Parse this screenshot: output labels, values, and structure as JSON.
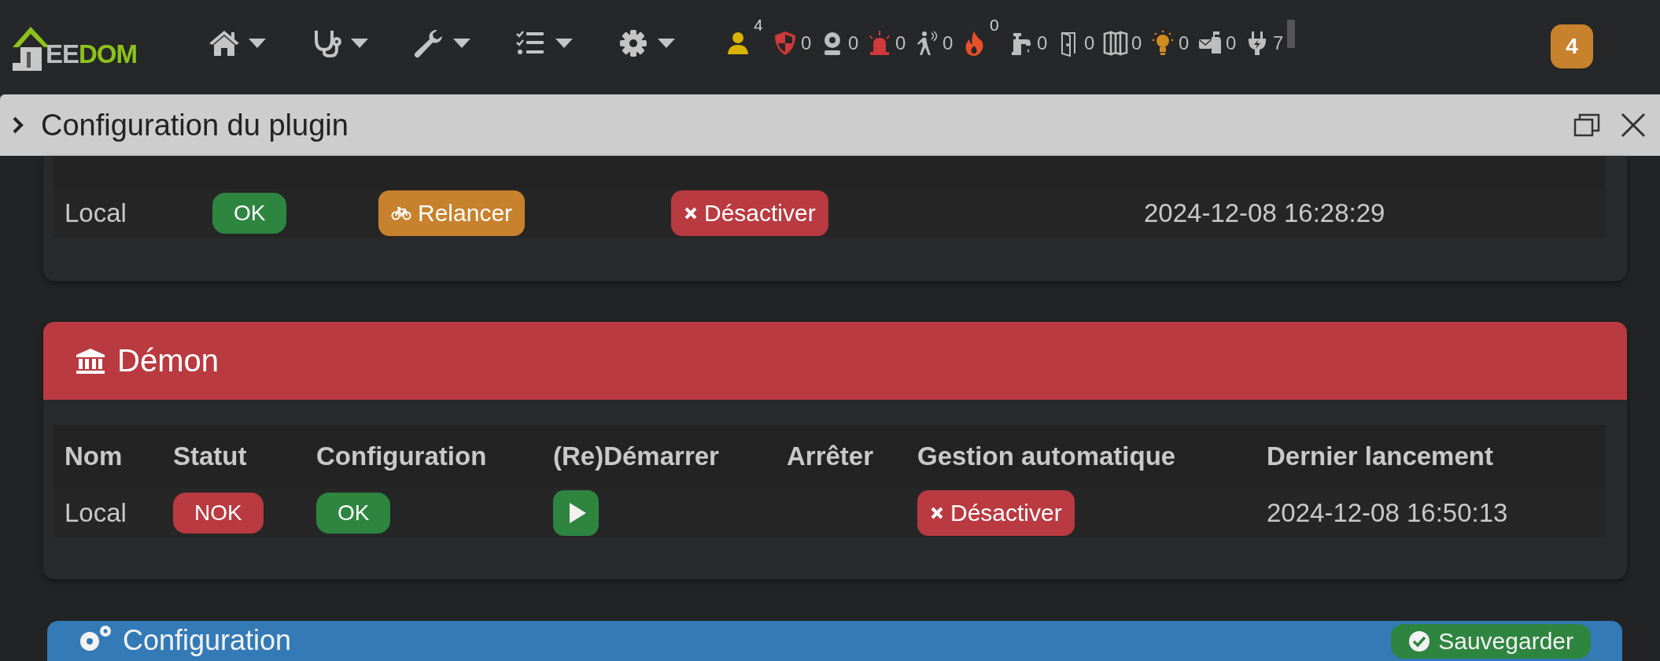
{
  "navbar": {
    "logo": {
      "part_1": "EE",
      "part_2": "DOM"
    },
    "menus": [
      {
        "kind": "home"
      },
      {
        "kind": "stethoscope"
      },
      {
        "kind": "wrench"
      },
      {
        "kind": "checklist"
      },
      {
        "kind": "gear"
      }
    ],
    "status": [
      {
        "kind": "person",
        "count": "4",
        "raised": true,
        "color": "#d9b300"
      },
      {
        "kind": "shield",
        "count": "0",
        "raised": false,
        "color": "#d03a3a"
      },
      {
        "kind": "camera",
        "count": "0",
        "raised": false,
        "color": "#bdbdbd"
      },
      {
        "kind": "siren",
        "count": "0",
        "raised": false,
        "color": "#d03a3a"
      },
      {
        "kind": "walker",
        "count": "0",
        "raised": false,
        "color": "#bdbdbd"
      },
      {
        "kind": "flame",
        "count": "0",
        "raised": true,
        "color": "#e8502a"
      },
      {
        "kind": "tap",
        "count": "0",
        "raised": false,
        "color": "#bdbdbd"
      },
      {
        "kind": "door",
        "count": "0",
        "raised": false,
        "color": "#bdbdbd"
      },
      {
        "kind": "window",
        "count": "0",
        "raised": false,
        "color": "#bdbdbd"
      },
      {
        "kind": "bulb",
        "count": "0",
        "raised": false,
        "color": "#d08a1e"
      },
      {
        "kind": "mailbox",
        "count": "0",
        "raised": false,
        "color": "#bdbdbd"
      },
      {
        "kind": "plug",
        "count": "7",
        "raised": false,
        "color": "#bdbdbd"
      }
    ],
    "notification_badge": "4"
  },
  "panel": {
    "title": "Configuration du plugin"
  },
  "dependencies": {
    "rows": [
      {
        "name": "Local",
        "status": {
          "label": "OK",
          "ok": true
        },
        "install_button": "Relancer",
        "auto_button": "Désactiver",
        "last": "2024-12-08 16:28:29"
      }
    ]
  },
  "daemon": {
    "title": "Démon",
    "ok": false,
    "columns": [
      "Nom",
      "Statut",
      "Configuration",
      "(Re)Démarrer",
      "Arrêter",
      "Gestion automatique",
      "Dernier lancement"
    ],
    "rows": [
      {
        "name": "Local",
        "status": {
          "label": "NOK",
          "ok": false
        },
        "config": {
          "label": "OK",
          "ok": true
        },
        "auto_button": "Désactiver",
        "last": "2024-12-08 16:50:13"
      }
    ]
  },
  "configuration": {
    "title": "Configuration",
    "save_button": "Sauvegarder"
  }
}
